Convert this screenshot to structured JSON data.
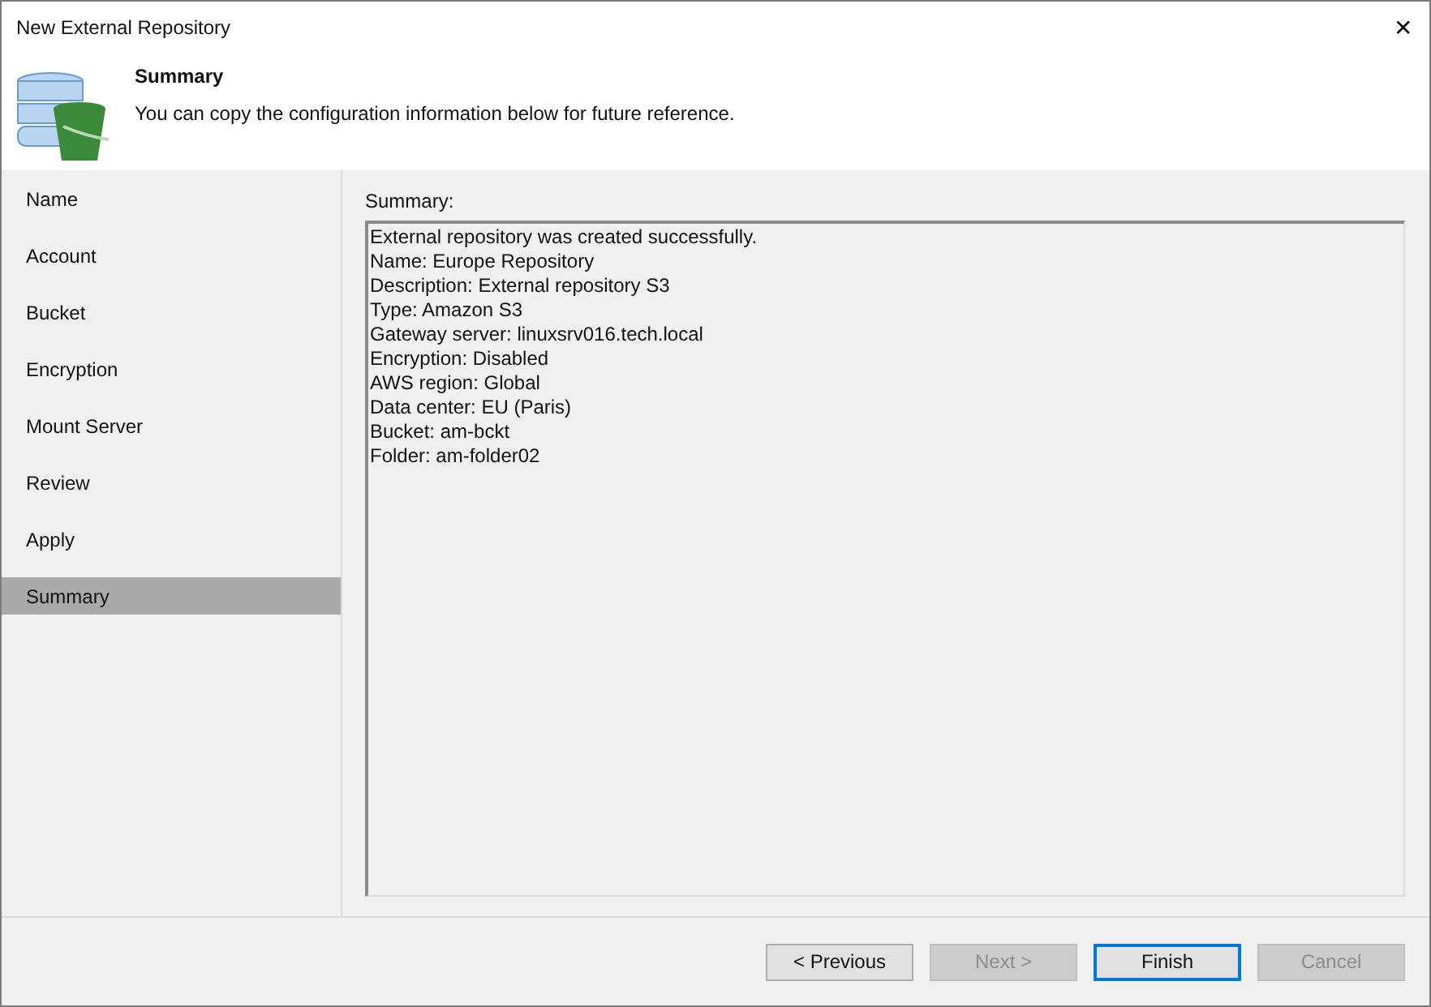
{
  "window": {
    "title": "New External Repository",
    "close": "✕"
  },
  "header": {
    "title": "Summary",
    "subtitle": "You can copy the configuration information below for future reference."
  },
  "steps": [
    {
      "label": "Name",
      "selected": false
    },
    {
      "label": "Account",
      "selected": false
    },
    {
      "label": "Bucket",
      "selected": false
    },
    {
      "label": "Encryption",
      "selected": false
    },
    {
      "label": "Mount Server",
      "selected": false
    },
    {
      "label": "Review",
      "selected": false
    },
    {
      "label": "Apply",
      "selected": false
    },
    {
      "label": "Summary",
      "selected": true
    }
  ],
  "summary": {
    "label": "Summary:",
    "lines": [
      "External repository was created successfully.",
      "Name: Europe Repository",
      "Description: External repository S3",
      "Type: Amazon S3",
      "Gateway server: linuxsrv016.tech.local",
      "Encryption: Disabled",
      "AWS region: Global",
      "Data center: EU (Paris)",
      "Bucket: am-bckt",
      "Folder: am-folder02"
    ]
  },
  "buttons": [
    {
      "label": "< Previous",
      "disabled": false,
      "default": false
    },
    {
      "label": "Next >",
      "disabled": true,
      "default": false
    },
    {
      "label": "Finish",
      "disabled": false,
      "default": true
    },
    {
      "label": "Cancel",
      "disabled": true,
      "default": false
    }
  ]
}
